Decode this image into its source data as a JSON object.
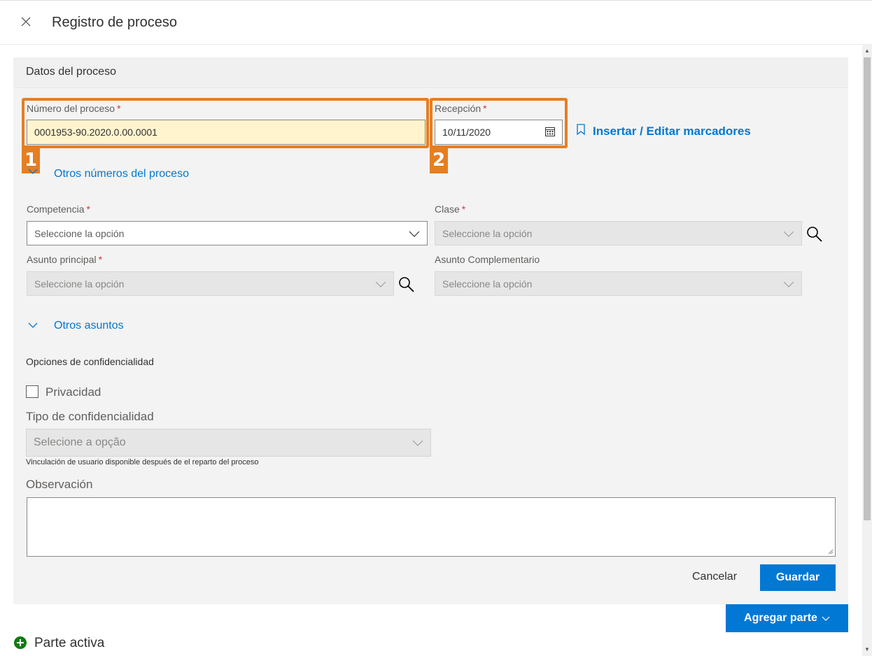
{
  "header": {
    "title": "Registro de proceso",
    "close_icon": "×"
  },
  "section": {
    "title": "Datos del proceso"
  },
  "numero": {
    "label": "Número del proceso",
    "required": "*",
    "value": "0001953-90.2020.0.00.0001"
  },
  "recepcion": {
    "label": "Recepción",
    "required": "*",
    "value": "10/11/2020"
  },
  "marcadores": {
    "label": "Insertar / Editar marcadores"
  },
  "badges": {
    "one": "1",
    "two": "2"
  },
  "otros_numeros": {
    "label": "Otros números del proceso"
  },
  "competencia": {
    "label": "Competencia",
    "required": "*",
    "placeholder": "Seleccione la opción"
  },
  "clase": {
    "label": "Clase",
    "required": "*",
    "placeholder": "Seleccione la opción"
  },
  "asunto_principal": {
    "label": "Asunto principal",
    "required": "*",
    "placeholder": "Seleccione la opción"
  },
  "asunto_complementario": {
    "label": "Asunto Complementario",
    "placeholder": "Seleccione la opción"
  },
  "otros_asuntos": {
    "label": "Otros asuntos"
  },
  "confidencialidad": {
    "title": "Opciones de confidencialidad",
    "privacidad_label": "Privacidad",
    "tipo_label": "Tipo de confidencialidad",
    "tipo_placeholder": "Selecione a opção",
    "hint": "Vinculación de usuario disponible después de el reparto del proceso"
  },
  "observacion": {
    "label": "Observación",
    "value": ""
  },
  "actions": {
    "cancel": "Cancelar",
    "save": "Guardar",
    "add_party": "Agregar parte"
  },
  "parte_activa": {
    "label": "Parte activa"
  },
  "colors": {
    "accent": "#0078d4",
    "highlight": "#e67e22",
    "required": "#d13438",
    "success": "#107c10"
  }
}
